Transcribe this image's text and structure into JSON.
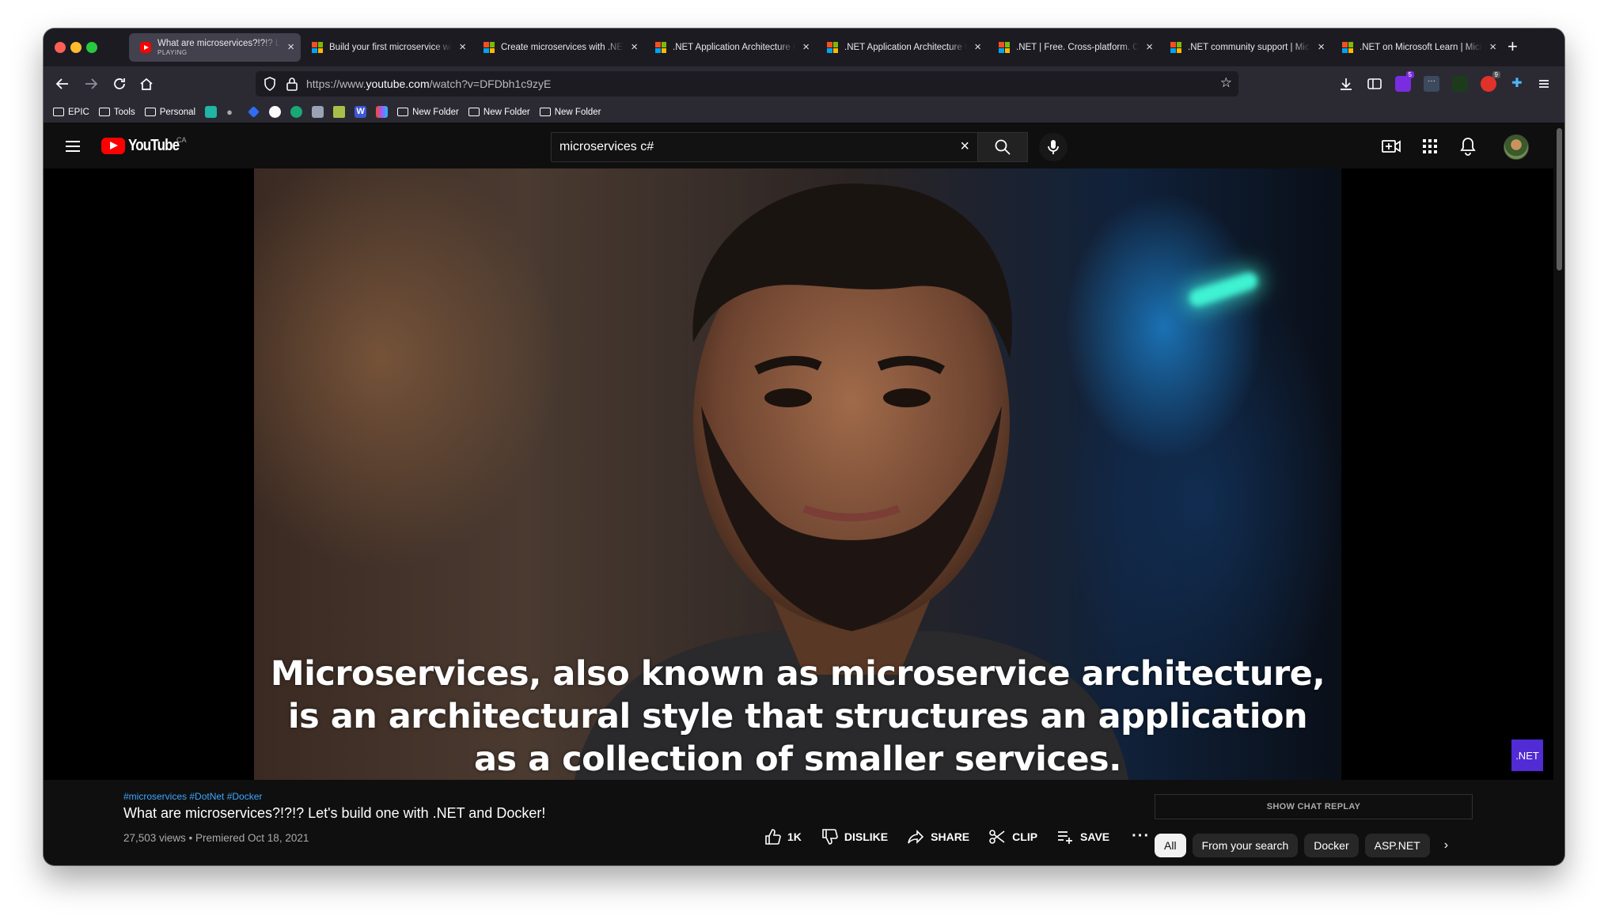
{
  "browser": {
    "tabs": [
      {
        "label": "What are microservices?!?!? Let's build one with .NET and Docker!",
        "sublabel": "PLAYING",
        "icon": "youtube-icon",
        "active": true
      },
      {
        "label": "Build your first microservice with .NET",
        "icon": "microsoft-icon"
      },
      {
        "label": "Create microservices with .NET and ASP.NET Core",
        "icon": "microsoft-icon"
      },
      {
        "label": ".NET Application Architecture Guides",
        "icon": "microsoft-icon"
      },
      {
        "label": ".NET Application Architecture Guides",
        "icon": "microsoft-icon"
      },
      {
        "label": ".NET | Free. Cross-platform. Open Source.",
        "icon": "microsoft-icon"
      },
      {
        "label": ".NET community support | Microsoft",
        "icon": "microsoft-icon"
      },
      {
        "label": ".NET on Microsoft Learn | Microsoft",
        "icon": "microsoft-icon"
      }
    ],
    "url": {
      "prefix": "https://www.",
      "host": "youtube.com",
      "path": "/watch?v=DFDbh1c9zyE"
    },
    "bookmarks": {
      "epic": "EPIC",
      "tools": "Tools",
      "personal": "Personal",
      "folder1": "New Folder",
      "folder2": "New Folder",
      "folder3": "New Folder"
    },
    "extension_badges": {
      "badge1": "5",
      "badge2": "9"
    }
  },
  "youtube": {
    "logo_text": "YouTube",
    "country": "CA",
    "search_value": "microservices c#"
  },
  "video": {
    "subtitle_lines": [
      "Microservices, also known as microservice architecture,",
      "is an architectural style that structures an application",
      "as a collection of smaller services."
    ],
    "badge": ".NET",
    "hashtags": "#microservices #DotNet #Docker",
    "title": "What are microservices?!?!? Let's build one with .NET and Docker!",
    "meta": "27,503 views • Premiered Oct 18, 2021",
    "actions": {
      "like": "1K",
      "dislike": "DISLIKE",
      "share": "SHARE",
      "clip": "CLIP",
      "save": "SAVE"
    }
  },
  "sidebar": {
    "chat_replay": "SHOW CHAT REPLAY",
    "chips": [
      "All",
      "From your search",
      "Docker",
      "ASP.NET"
    ]
  },
  "colors": {
    "accent": "#ff0000",
    "link": "#3ea6ff",
    "dotnet": "#512bd4"
  }
}
